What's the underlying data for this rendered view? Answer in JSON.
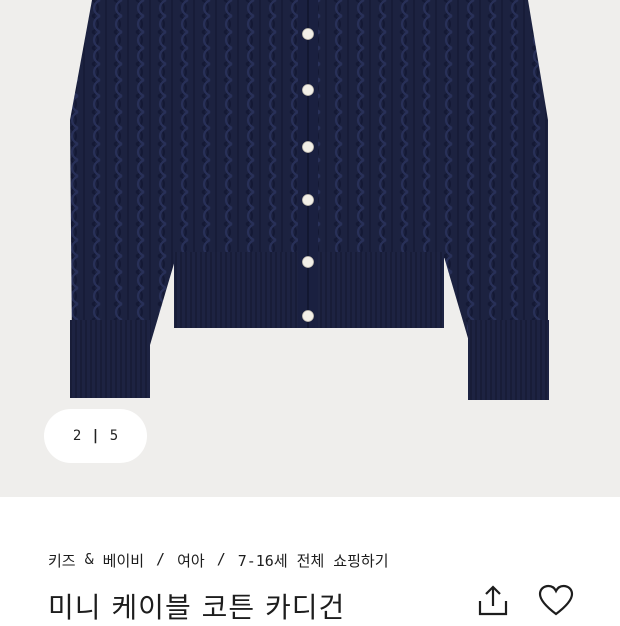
{
  "product_image": {
    "alt_icon": "navy-cable-knit-cardigan-image",
    "background_color": "#efeeec",
    "garment_color": "#1c2240",
    "button_color": "#f2efe8"
  },
  "gallery": {
    "current": "2",
    "separator": "|",
    "total": "5"
  },
  "breadcrumb": {
    "items": [
      "키즈",
      "&",
      "베이비",
      "/",
      "여아",
      "/",
      "7-16세 전체 쇼핑하기"
    ]
  },
  "product": {
    "title": "미니 케이블 코튼 카디건"
  },
  "actions": {
    "share_icon": "share-icon",
    "wishlist_icon": "heart-icon"
  }
}
